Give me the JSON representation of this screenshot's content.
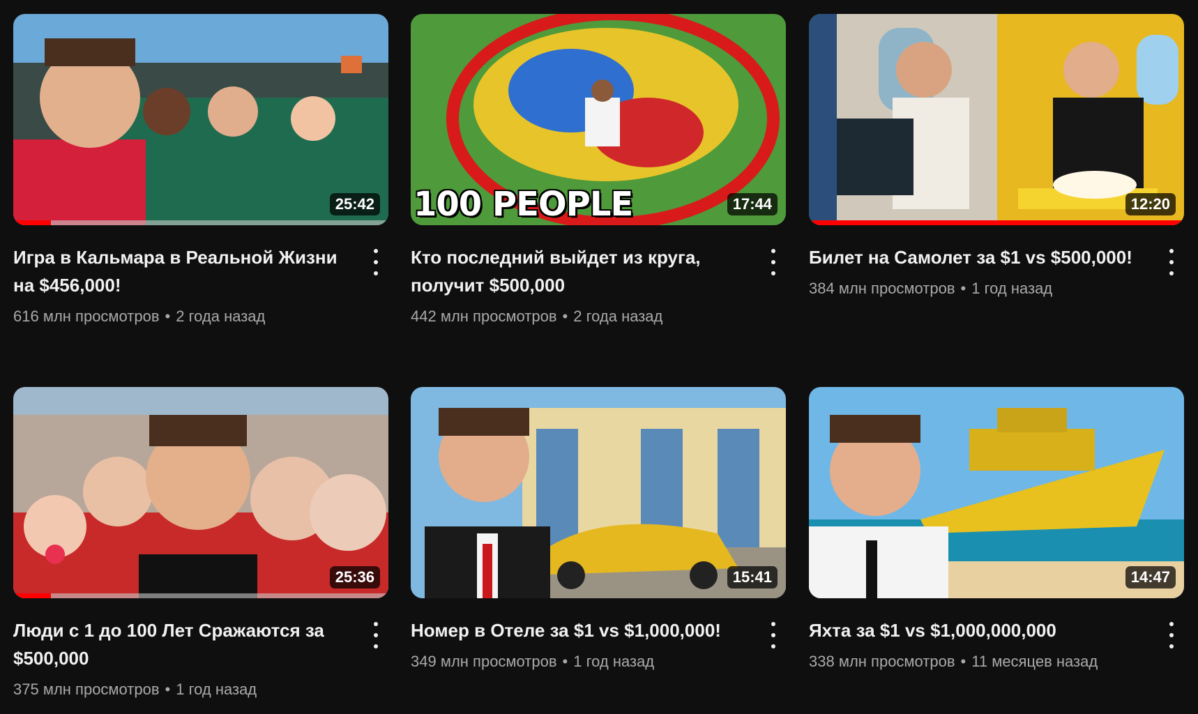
{
  "videos": [
    {
      "title": "Игра в Кальмара в Реальной Жизни на $456,000!",
      "views": "616 млн просмотров",
      "age": "2 года назад",
      "duration": "25:42",
      "progress": 0.1,
      "thumb_text": ""
    },
    {
      "title": "Кто последний выйдет из круга, получит $500,000",
      "views": "442 млн просмотров",
      "age": "2 года назад",
      "duration": "17:44",
      "progress": 0,
      "thumb_text": "100 PEOPLE"
    },
    {
      "title": "Билет на Самолет за $1 vs $500,000!",
      "views": "384 млн просмотров",
      "age": "1 год назад",
      "duration": "12:20",
      "progress": 1.0,
      "thumb_text": ""
    },
    {
      "title": "Люди с 1 до 100 Лет Сражаются за $500,000",
      "views": "375 млн просмотров",
      "age": "1 год назад",
      "duration": "25:36",
      "progress": 0.1,
      "thumb_text": ""
    },
    {
      "title": "Номер в Отеле за $1 vs $1,000,000!",
      "views": "349 млн просмотров",
      "age": "1 год назад",
      "duration": "15:41",
      "progress": 0,
      "thumb_text": ""
    },
    {
      "title": "Яхта за $1 vs $1,000,000,000",
      "views": "338 млн просмотров",
      "age": "11 месяцев назад",
      "duration": "14:47",
      "progress": 0,
      "thumb_text": ""
    }
  ],
  "separator": "•",
  "icons": {
    "menu": "more-vert-icon"
  },
  "colors": {
    "background": "#0f0f0f",
    "progress": "#ff0000",
    "meta_text": "#aaaaaa"
  }
}
